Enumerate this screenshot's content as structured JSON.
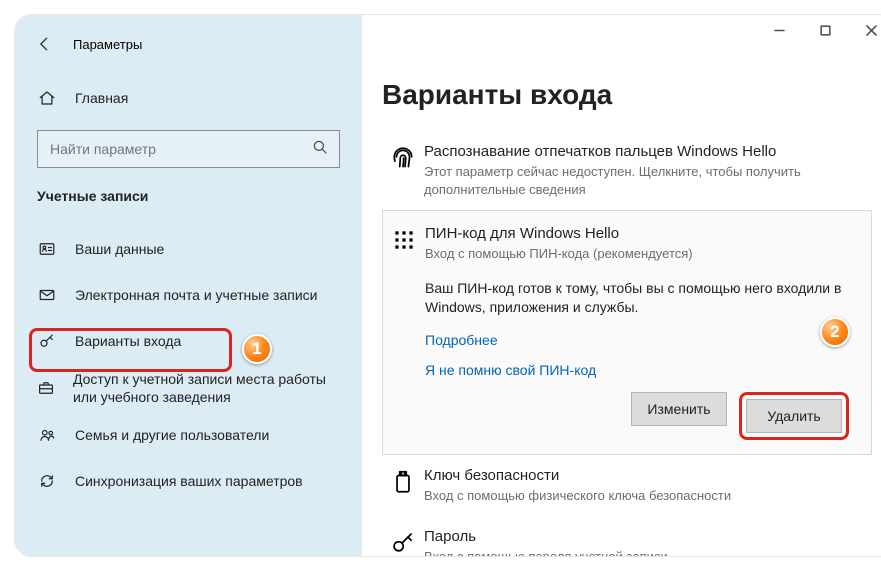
{
  "app": {
    "title": "Параметры"
  },
  "nav": {
    "home": "Главная",
    "search_placeholder": "Найти параметр",
    "section": "Учетные записи",
    "items": {
      "your_info": "Ваши данные",
      "email": "Электронная почта и учетные записи",
      "signin": "Варианты входа",
      "work": "Доступ к учетной записи места работы или учебного заведения",
      "family": "Семья и другие пользователи",
      "sync": "Синхронизация ваших параметров"
    }
  },
  "page": {
    "title": "Варианты входа",
    "fingerprint": {
      "title": "Распознавание отпечатков пальцев Windows Hello",
      "sub": "Этот параметр сейчас недоступен. Щелкните, чтобы получить дополнительные сведения"
    },
    "pin": {
      "title": "ПИН-код для Windows Hello",
      "sub": "Вход с помощью ПИН-кода (рекомендуется)",
      "msg": "Ваш ПИН-код готов к тому, чтобы вы с помощью него входили в Windows, приложения и службы.",
      "more": "Подробнее",
      "forgot": "Я не помню свой ПИН-код",
      "change": "Изменить",
      "remove": "Удалить"
    },
    "key": {
      "title": "Ключ безопасности",
      "sub": "Вход с помощью физического ключа безопасности"
    },
    "password": {
      "title": "Пароль",
      "sub": "Вход с помощью пароля учетной записи"
    }
  },
  "annotations": {
    "n1": "1",
    "n2": "2"
  }
}
